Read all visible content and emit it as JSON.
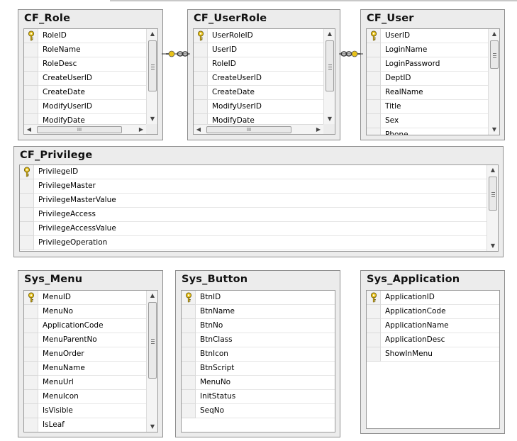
{
  "tables": {
    "cf_role": {
      "title": "CF_Role",
      "columns": [
        "RoleID",
        "RoleName",
        "RoleDesc",
        "CreateUserID",
        "CreateDate",
        "ModifyUserID",
        "ModifyDate"
      ],
      "primary_key": "RoleID"
    },
    "cf_userrole": {
      "title": "CF_UserRole",
      "columns": [
        "UserRoleID",
        "UserID",
        "RoleID",
        "CreateUserID",
        "CreateDate",
        "ModifyUserID",
        "ModifyDate"
      ],
      "primary_key": "UserRoleID"
    },
    "cf_user": {
      "title": "CF_User",
      "columns": [
        "UserID",
        "LoginName",
        "LoginPassword",
        "DeptID",
        "RealName",
        "Title",
        "Sex",
        "Phone"
      ],
      "primary_key": "UserID"
    },
    "cf_privilege": {
      "title": "CF_Privilege",
      "columns": [
        "PrivilegeID",
        "PrivilegeMaster",
        "PrivilegeMasterValue",
        "PrivilegeAccess",
        "PrivilegeAccessValue",
        "PrivilegeOperation"
      ],
      "primary_key": "PrivilegeID"
    },
    "sys_menu": {
      "title": "Sys_Menu",
      "columns": [
        "MenuID",
        "MenuNo",
        "ApplicationCode",
        "MenuParentNo",
        "MenuOrder",
        "MenuName",
        "MenuUrl",
        "MenuIcon",
        "IsVisible",
        "IsLeaf"
      ],
      "primary_key": "MenuID"
    },
    "sys_button": {
      "title": "Sys_Button",
      "columns": [
        "BtnID",
        "BtnName",
        "BtnNo",
        "BtnClass",
        "BtnIcon",
        "BtnScript",
        "MenuNo",
        "InitStatus",
        "SeqNo"
      ],
      "primary_key": "BtnID"
    },
    "sys_application": {
      "title": "Sys_Application",
      "columns": [
        "ApplicationID",
        "ApplicationCode",
        "ApplicationName",
        "ApplicationDesc",
        "ShowInMenu"
      ],
      "primary_key": "ApplicationID"
    }
  },
  "relationships": [
    {
      "from": "cf_role",
      "to": "cf_userrole",
      "one_end": "cf_role",
      "many_end": "cf_userrole"
    },
    {
      "from": "cf_userrole",
      "to": "cf_user",
      "one_end": "cf_user",
      "many_end": "cf_userrole"
    }
  ],
  "scroll_thumb_glyph": "III",
  "colors": {
    "key_gold": "#e8c21a",
    "connector": "#333333",
    "table_bg": "#ececec"
  }
}
